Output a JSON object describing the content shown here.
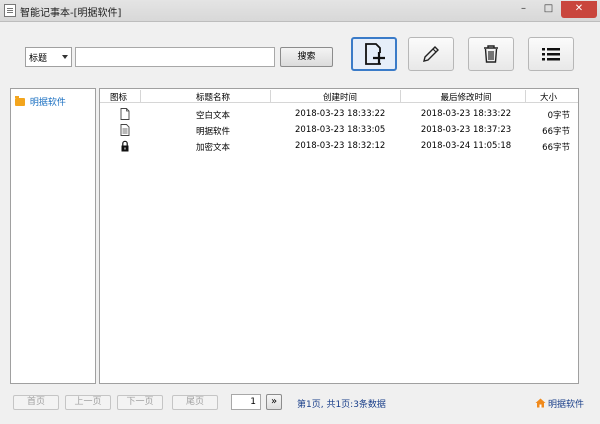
{
  "window": {
    "title": "智能记事本-[明据软件]",
    "controls": {
      "minimize": "–",
      "maximize": "□",
      "close": "✕"
    }
  },
  "toolbar": {
    "field_select": "标题",
    "search_placeholder": "",
    "search_value": "",
    "search_label": "搜索",
    "buttons": [
      {
        "name": "new-note-button",
        "icon": "new-document-icon",
        "active": true
      },
      {
        "name": "edit-note-button",
        "icon": "pencil-icon",
        "active": false
      },
      {
        "name": "delete-note-button",
        "icon": "trash-icon",
        "active": false
      },
      {
        "name": "list-view-button",
        "icon": "list-icon",
        "active": false
      }
    ]
  },
  "tree": {
    "items": [
      {
        "label": "明据软件",
        "icon": "folder-icon"
      }
    ]
  },
  "table": {
    "headers": {
      "icon": "图标",
      "title": "标题名称",
      "created": "创建时间",
      "modified": "最后修改时间",
      "size": "大小"
    },
    "rows": [
      {
        "icon": "blank-document-icon",
        "title": "空白文本",
        "created": "2018-03-23 18:33:22",
        "modified": "2018-03-23 18:33:22",
        "size": "0字节"
      },
      {
        "icon": "text-document-icon",
        "title": "明据软件",
        "created": "2018-03-23 18:33:05",
        "modified": "2018-03-23 18:37:23",
        "size": "66字节"
      },
      {
        "icon": "lock-icon",
        "title": "加密文本",
        "created": "2018-03-23 18:32:12",
        "modified": "2018-03-24 11:05:18",
        "size": "66字节"
      }
    ]
  },
  "footer": {
    "first_page": "首页",
    "prev_page": "上一页",
    "next_page": "下一页",
    "last_page": "尾页",
    "page_input": "1",
    "go_label": "»",
    "status": "第1页, 共1页:3条数据",
    "home_link": "明据软件"
  },
  "colors": {
    "accent": "#3a7bc8",
    "link": "#1a3f8a",
    "folder": "#f3a51d",
    "home_icon": "#f08a1c",
    "close_button": "#c9463d"
  }
}
